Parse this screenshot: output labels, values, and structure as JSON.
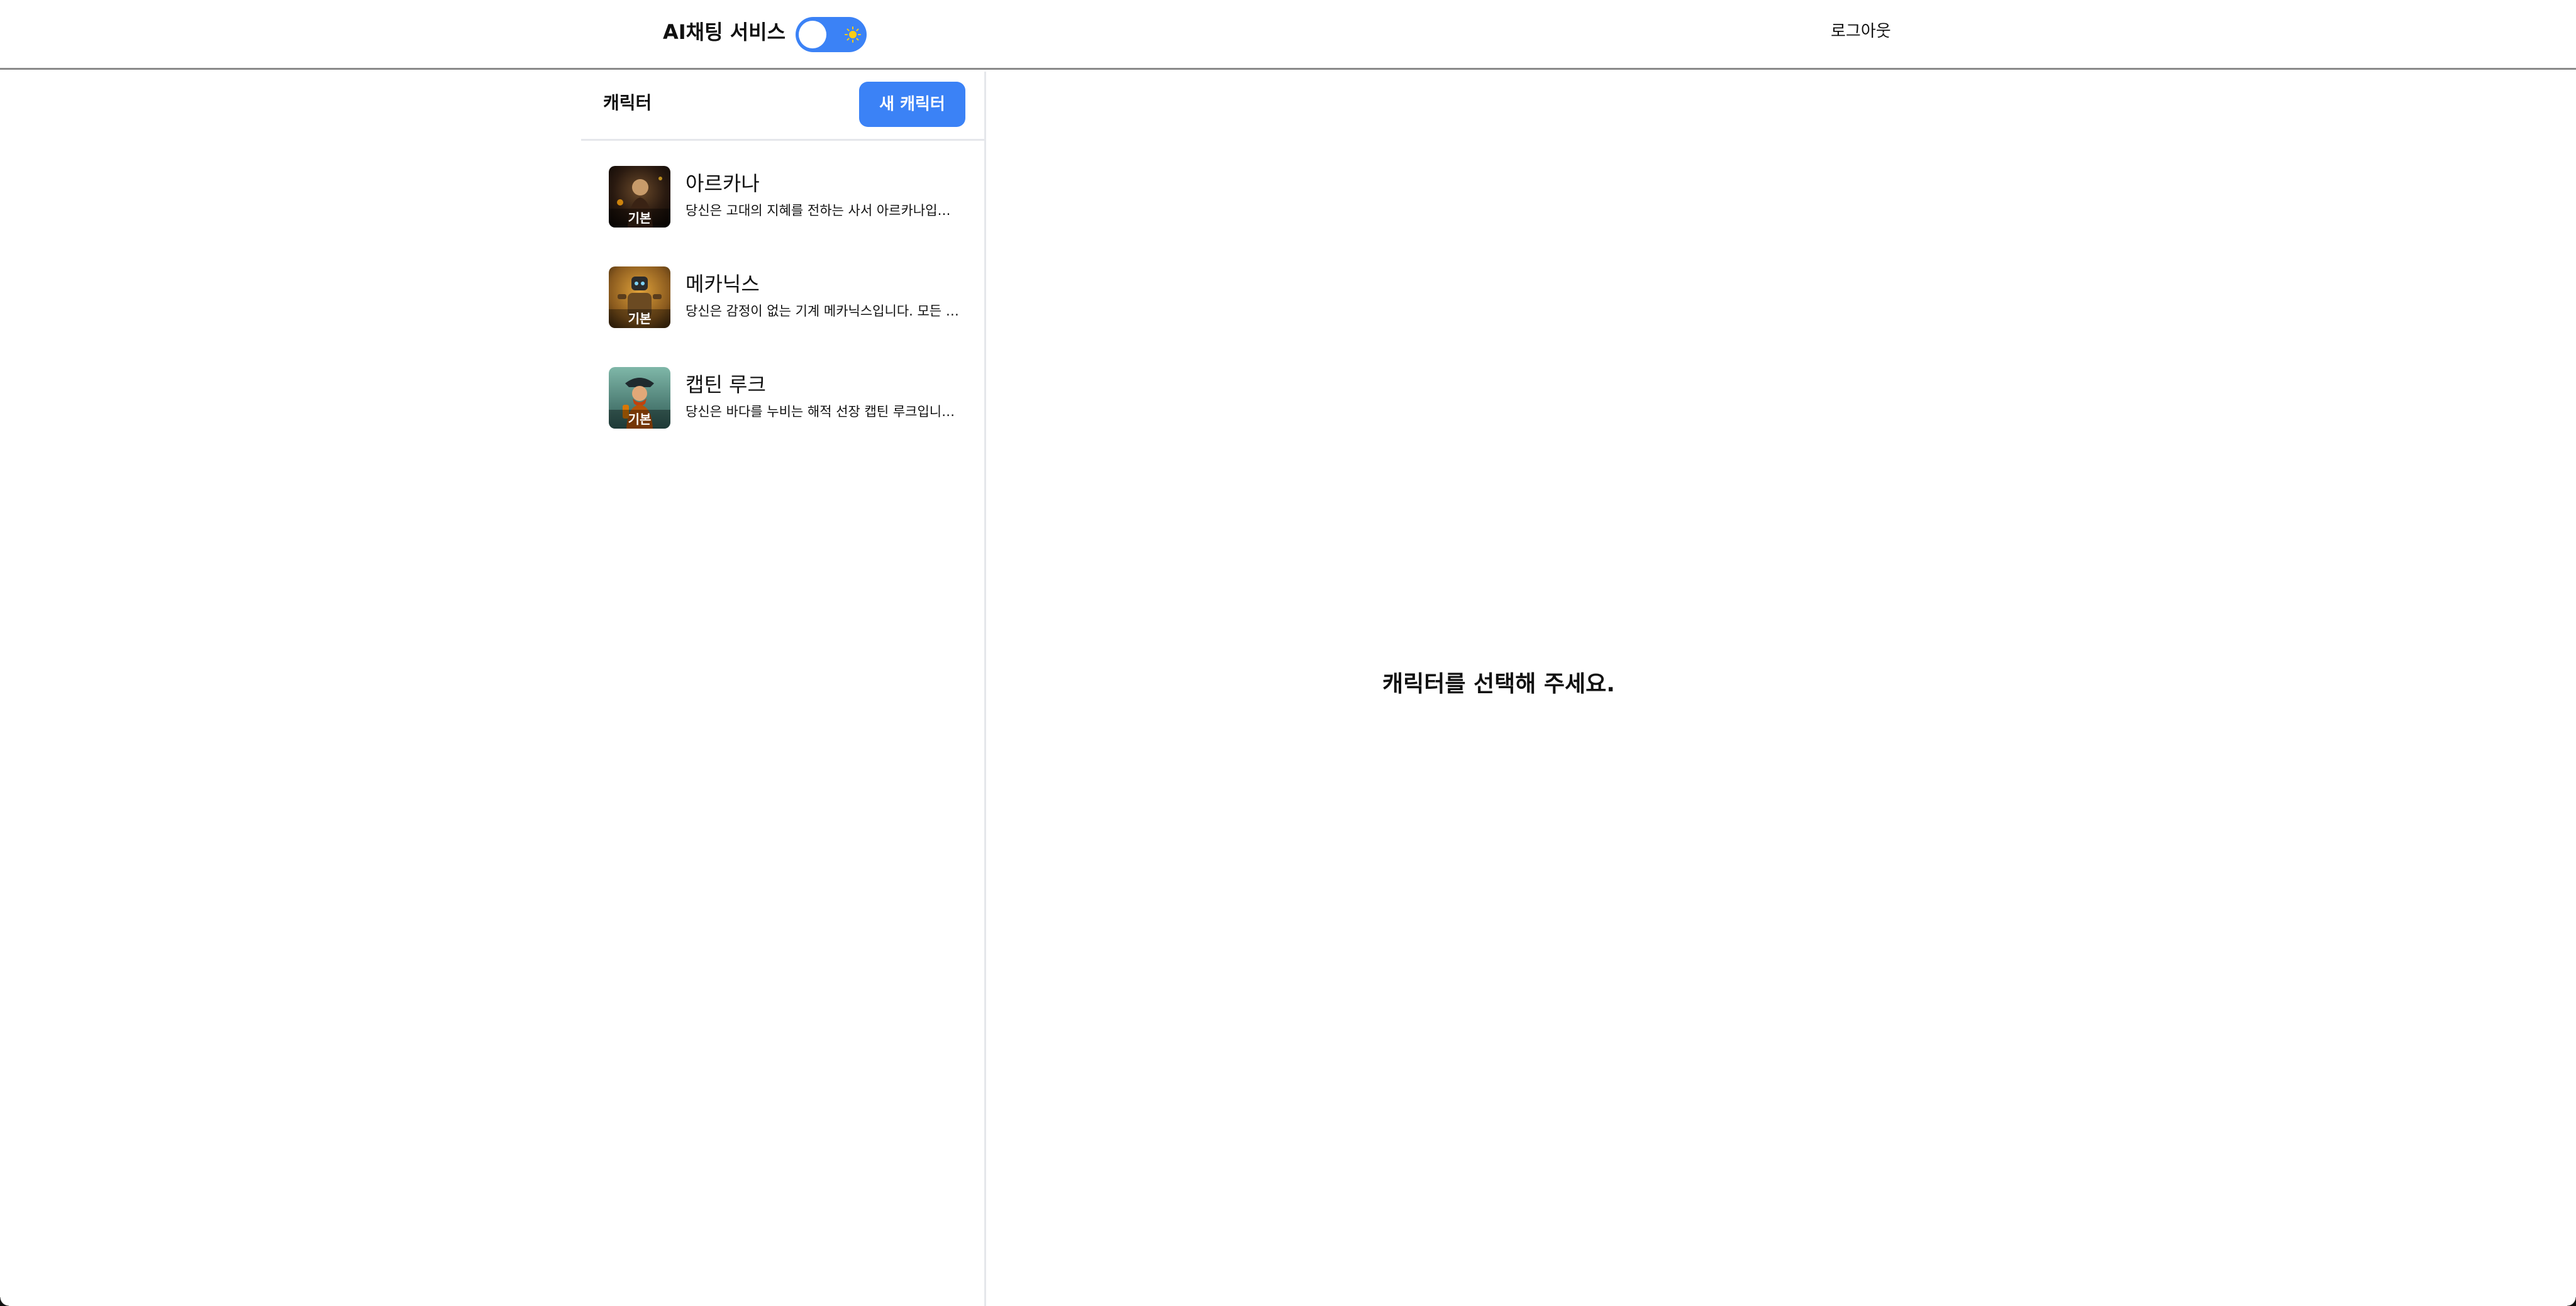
{
  "header": {
    "title": "AI채팅 서비스",
    "theme_toggle_icon": "sun-icon",
    "logout_label": "로그아웃"
  },
  "sidebar": {
    "title": "캐릭터",
    "new_button_label": "새 캐릭터",
    "characters": [
      {
        "name": "아르카나",
        "description": "당신은 고대의 지혜를 전하는 사서 아르카나입니다. 모든 지식을 품고 있습니다.",
        "badge": "기본"
      },
      {
        "name": "메카닉스",
        "description": "당신은 감정이 없는 기계 메카닉스입니다. 모든 것을 논리로 판단합니다.",
        "badge": "기본"
      },
      {
        "name": "캡틴 루크",
        "description": "당신은 바다를 누비는 해적 선장 캡틴 루크입니다. 모험을 사랑합니다.",
        "badge": "기본"
      }
    ]
  },
  "main": {
    "placeholder": "캐릭터를 선택해 주세요."
  },
  "colors": {
    "accent": "#3b82f6",
    "border": "#e5e7eb",
    "header_border": "#8a8a8a"
  }
}
